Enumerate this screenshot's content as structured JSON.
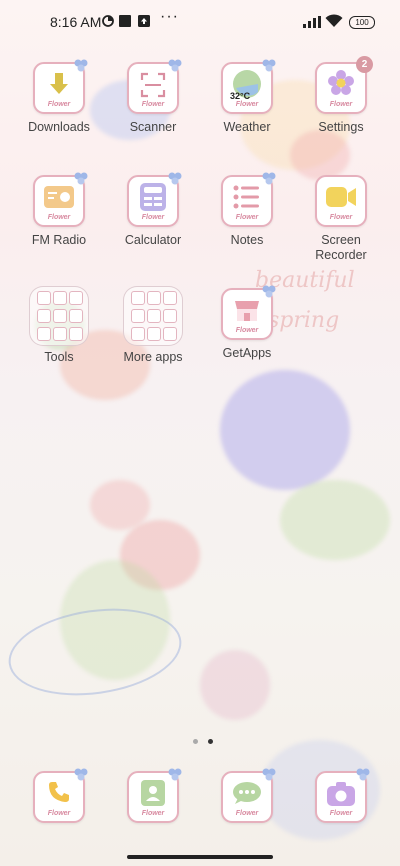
{
  "status_bar": {
    "time": "8:16 AM",
    "battery": "100"
  },
  "apps": [
    {
      "id": "downloads",
      "label": "Downloads",
      "ribbon": "Flower"
    },
    {
      "id": "scanner",
      "label": "Scanner",
      "ribbon": "Flower"
    },
    {
      "id": "weather",
      "label": "Weather",
      "ribbon": "Flower",
      "temp": "32°C"
    },
    {
      "id": "settings",
      "label": "Settings",
      "ribbon": "Flower",
      "badge": "2"
    },
    {
      "id": "fm-radio",
      "label": "FM Radio",
      "ribbon": "Flower"
    },
    {
      "id": "calculator",
      "label": "Calculator",
      "ribbon": "Flower"
    },
    {
      "id": "notes",
      "label": "Notes",
      "ribbon": "Flower"
    },
    {
      "id": "screen-recorder",
      "label": "Screen Recorder",
      "ribbon": "Flower"
    },
    {
      "id": "tools",
      "label": "Tools"
    },
    {
      "id": "more-apps",
      "label": "More apps"
    },
    {
      "id": "getapps",
      "label": "GetApps",
      "ribbon": "Flower"
    }
  ],
  "dock": [
    {
      "id": "phone",
      "ribbon": "Flower"
    },
    {
      "id": "contacts",
      "ribbon": "Flower"
    },
    {
      "id": "messages",
      "ribbon": "Flower"
    },
    {
      "id": "camera",
      "ribbon": "Flower"
    }
  ],
  "wallpaper_text": {
    "line1": "beautiful",
    "line2": "spring"
  },
  "pager": {
    "pages": 2,
    "current": 2
  }
}
